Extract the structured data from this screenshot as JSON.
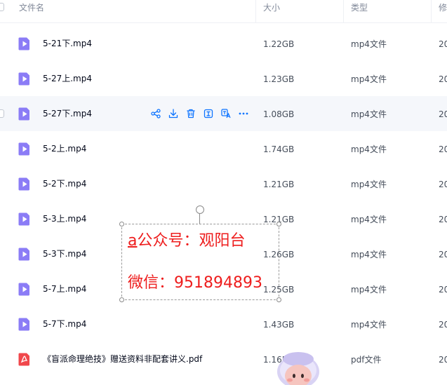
{
  "header": {
    "name": "文件名",
    "size": "大小",
    "type": "类型",
    "modified": "修"
  },
  "rows": [
    {
      "name": "5-21下.mp4",
      "size": "1.22GB",
      "type": "mp4文件",
      "date": "20",
      "icon": "video-file-icon"
    },
    {
      "name": "5-27上.mp4",
      "size": "1.23GB",
      "type": "mp4文件",
      "date": "20",
      "icon": "video-file-icon"
    },
    {
      "name": "5-27下.mp4",
      "size": "1.08GB",
      "type": "mp4文件",
      "date": "20",
      "icon": "video-file-icon"
    },
    {
      "name": "5-2上.mp4",
      "size": "1.74GB",
      "type": "mp4文件",
      "date": "20",
      "icon": "video-file-icon"
    },
    {
      "name": "5-2下.mp4",
      "size": "1.21GB",
      "type": "mp4文件",
      "date": "20",
      "icon": "video-file-icon"
    },
    {
      "name": "5-3上.mp4",
      "size": "1.21GB",
      "type": "mp4文件",
      "date": "20",
      "icon": "video-file-icon"
    },
    {
      "name": "5-3下.mp4",
      "size": "1.26GB",
      "type": "mp4文件",
      "date": "20",
      "icon": "video-file-icon"
    },
    {
      "name": "5-7上.mp4",
      "size": "1.25GB",
      "type": "mp4文件",
      "date": "20",
      "icon": "video-file-icon"
    },
    {
      "name": "5-7下.mp4",
      "size": "1.43GB",
      "type": "mp4文件",
      "date": "20",
      "icon": "video-file-icon"
    },
    {
      "name": "《盲派命理绝技》赠送资料非配套讲义.pdf",
      "size": "1.16M",
      "type": "pdf文件",
      "date": "20",
      "icon": "pdf-file-icon"
    }
  ],
  "hover_actions": [
    "share-icon",
    "download-icon",
    "delete-icon",
    "extract-text-icon",
    "translate-icon",
    "more-icon"
  ],
  "watermark": {
    "prefix": "a",
    "line1": "公众号：观阳台",
    "line2": "微信：951894893"
  },
  "colors": {
    "video_icon": "#8b7cf6",
    "pdf_icon": "#f0474b",
    "action_icon": "#0d74ff",
    "watermark": "#ee1d1d",
    "hover_row": "#f5f7fb"
  }
}
